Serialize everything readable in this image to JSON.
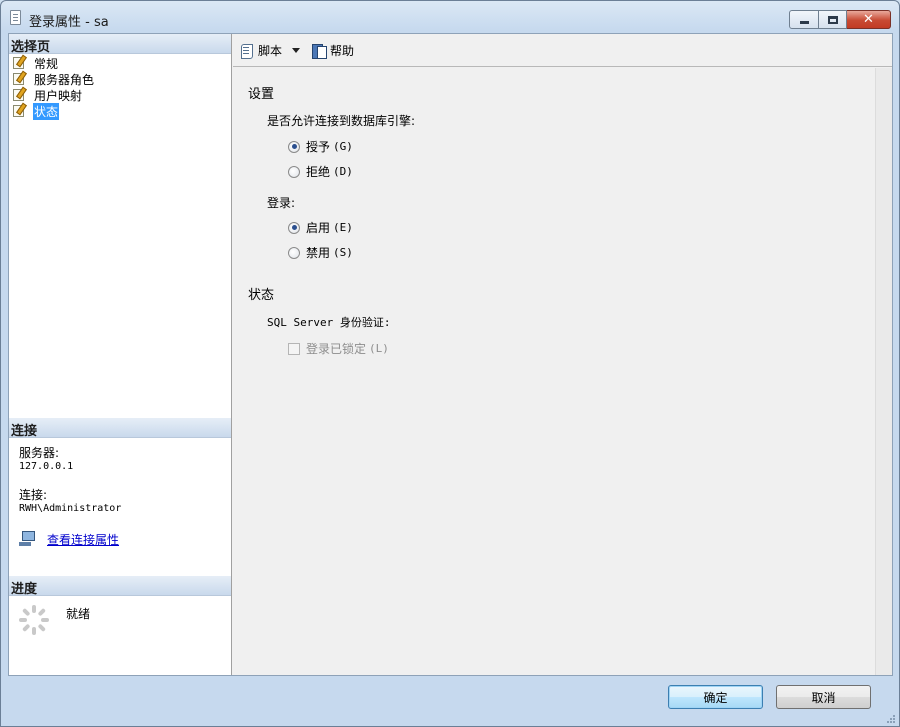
{
  "window": {
    "title": "登录属性 - sa",
    "colors": {
      "accent": "#3399ff",
      "link": "#0000cc",
      "close": "#c84a33"
    }
  },
  "left": {
    "select_page_header": "选择页",
    "nav_items": [
      {
        "label": "常规",
        "icon": "page-edit-icon",
        "selected": false
      },
      {
        "label": "服务器角色",
        "icon": "page-edit-icon",
        "selected": false
      },
      {
        "label": "用户映射",
        "icon": "page-edit-icon",
        "selected": false
      },
      {
        "label": "状态",
        "icon": "page-edit-icon",
        "selected": true
      }
    ],
    "connection_header": "连接",
    "server_label": "服务器:",
    "server_value": "127.0.0.1",
    "connection_label": "连接:",
    "connection_value": "RWH\\Administrator",
    "view_link": "查看连接属性",
    "progress_header": "进度",
    "progress_status": "就绪"
  },
  "toolbar": {
    "script_label": "脚本",
    "help_label": "帮助"
  },
  "content": {
    "settings_heading": "设置",
    "permission_question": "是否允许连接到数据库引擎:",
    "grant_label": "授予",
    "grant_key": "(G)",
    "deny_label": "拒绝",
    "deny_key": "(D)",
    "permission_selected": "grant",
    "login_label": "登录:",
    "enable_label": "启用",
    "enable_key": "(E)",
    "disable_label": "禁用",
    "disable_key": "(S)",
    "login_selected": "enable",
    "status_heading": "状态",
    "sql_auth_label": "SQL Server 身份验证:",
    "locked_label": "登录已锁定",
    "locked_key": "(L)",
    "locked_checked": false
  },
  "footer": {
    "ok_label": "确定",
    "cancel_label": "取消"
  }
}
